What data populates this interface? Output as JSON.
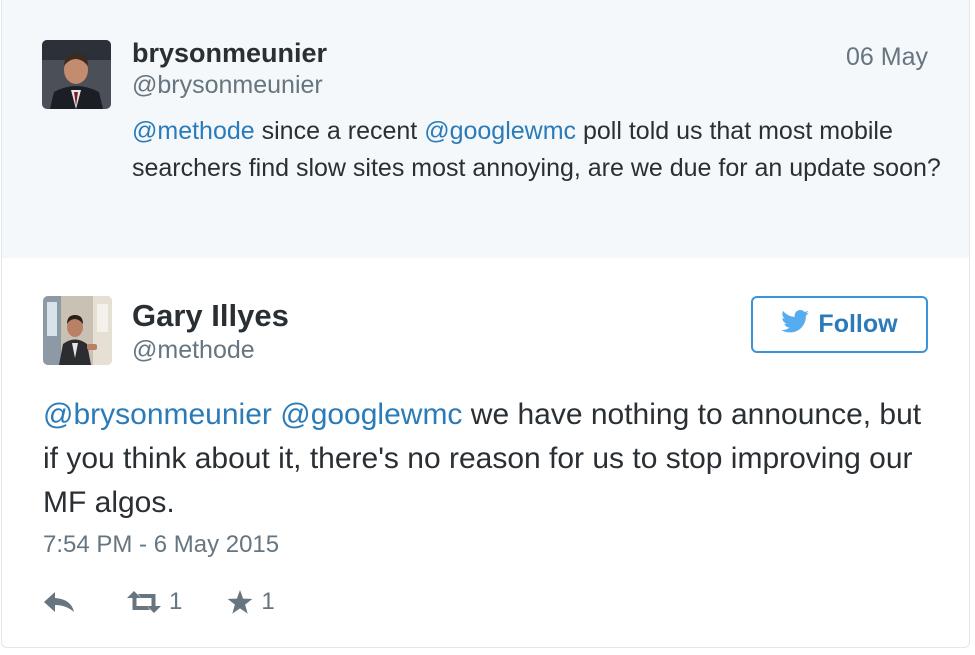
{
  "parent_tweet": {
    "display_name": "brysonmeunier",
    "handle": "@brysonmeunier",
    "date": "06 May",
    "text_parts": [
      {
        "text": "@methode",
        "type": "mention"
      },
      {
        "text": " since a recent ",
        "type": "text"
      },
      {
        "text": "@googlewmc",
        "type": "mention"
      },
      {
        "text": " poll told us that most mobile searchers find slow sites most annoying, are we due for an update soon?",
        "type": "text"
      }
    ]
  },
  "main_tweet": {
    "display_name": "Gary Illyes",
    "handle": "@methode",
    "follow_label": "Follow",
    "text_parts": [
      {
        "text": "@brysonmeunier",
        "type": "mention"
      },
      {
        "text": " ",
        "type": "text"
      },
      {
        "text": "@googlewmc",
        "type": "mention"
      },
      {
        "text": " we have nothing to announce, but if you think about it, there's no reason for us to stop improving our MF algos.",
        "type": "text"
      }
    ],
    "timestamp": "7:54 PM - 6 May 2015",
    "retweet_count": "1",
    "favorite_count": "1"
  },
  "icons": {
    "reply": "reply-icon",
    "retweet": "retweet-icon",
    "favorite": "star-icon",
    "follow": "twitter-bird-icon"
  },
  "colors": {
    "link": "#2b7bb9",
    "follow_border": "#3b94d9",
    "parent_background": "#f5f8fa",
    "muted": "#66757f"
  }
}
